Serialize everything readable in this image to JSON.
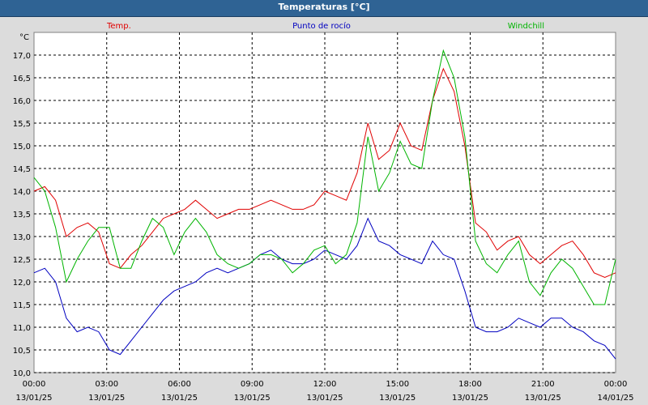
{
  "window": {
    "title": "Temperaturas [°C]"
  },
  "chart_data": {
    "type": "line",
    "ylabel": "°C",
    "ylim": [
      10.0,
      17.0
    ],
    "y_ticks": [
      "10,0",
      "10,5",
      "11,0",
      "11,5",
      "12,0",
      "12,5",
      "13,0",
      "13,5",
      "14,0",
      "14,5",
      "15,0",
      "15,5",
      "16,0",
      "16,5",
      "17,0"
    ],
    "xlim": [
      "2025-01-13T00:00",
      "2025-01-14T00:00"
    ],
    "x_ticks": [
      {
        "time": "00:00",
        "date": "13/01/25"
      },
      {
        "time": "03:00",
        "date": "13/01/25"
      },
      {
        "time": "06:00",
        "date": "13/01/25"
      },
      {
        "time": "09:00",
        "date": "13/01/25"
      },
      {
        "time": "12:00",
        "date": "13/01/25"
      },
      {
        "time": "15:00",
        "date": "13/01/25"
      },
      {
        "time": "18:00",
        "date": "13/01/25"
      },
      {
        "time": "21:00",
        "date": "13/01/25"
      },
      {
        "time": "00:00",
        "date": "14/01/25"
      }
    ],
    "grid": true,
    "x_hours": [
      0,
      0.5,
      1,
      1.5,
      2,
      2.5,
      3,
      3.5,
      4,
      4.5,
      5,
      5.5,
      6,
      6.5,
      7,
      7.5,
      8,
      8.5,
      9,
      9.5,
      10,
      10.5,
      11,
      11.5,
      12,
      12.5,
      13,
      13.5,
      14,
      14.5,
      15,
      15.5,
      16,
      16.5,
      17,
      17.5,
      18,
      18.5,
      19,
      19.5,
      20,
      20.5,
      21,
      21.5,
      22,
      22.5,
      23,
      23.5,
      24
    ],
    "series": [
      {
        "name": "Temp.",
        "color": "#e00000",
        "values": [
          14.0,
          14.1,
          13.8,
          13.0,
          13.2,
          13.3,
          13.1,
          12.4,
          12.3,
          12.6,
          12.8,
          13.1,
          13.4,
          13.5,
          13.6,
          13.8,
          13.6,
          13.4,
          13.5,
          13.6,
          13.6,
          13.7,
          13.8,
          13.7,
          13.6,
          13.6,
          13.7,
          14.0,
          13.9,
          13.8,
          14.4,
          15.5,
          14.7,
          14.9,
          15.5,
          15.0,
          14.9,
          16.0,
          16.7,
          16.2,
          15.0,
          13.3,
          13.1,
          12.7,
          12.9,
          13.0,
          12.6,
          12.4,
          12.6,
          12.8,
          12.9,
          12.6,
          12.2,
          12.1,
          12.2
        ]
      },
      {
        "name": "Punto de rocío",
        "color": "#0000c0",
        "values": [
          12.2,
          12.3,
          12.0,
          11.2,
          10.9,
          11.0,
          10.9,
          10.5,
          10.4,
          10.7,
          11.0,
          11.3,
          11.6,
          11.8,
          11.9,
          12.0,
          12.2,
          12.3,
          12.2,
          12.3,
          12.4,
          12.6,
          12.7,
          12.5,
          12.4,
          12.4,
          12.5,
          12.7,
          12.6,
          12.5,
          12.8,
          13.4,
          12.9,
          12.8,
          12.6,
          12.5,
          12.4,
          12.9,
          12.6,
          12.5,
          11.8,
          11.0,
          10.9,
          10.9,
          11.0,
          11.2,
          11.1,
          11.0,
          11.2,
          11.2,
          11.0,
          10.9,
          10.7,
          10.6,
          10.3
        ]
      },
      {
        "name": "Windchill",
        "color": "#00b400",
        "values": [
          14.3,
          14.0,
          13.2,
          12.0,
          12.5,
          12.9,
          13.2,
          13.2,
          12.3,
          12.3,
          12.9,
          13.4,
          13.2,
          12.6,
          13.1,
          13.4,
          13.1,
          12.6,
          12.4,
          12.3,
          12.4,
          12.6,
          12.6,
          12.5,
          12.2,
          12.4,
          12.7,
          12.8,
          12.4,
          12.6,
          13.3,
          15.2,
          14.0,
          14.4,
          15.1,
          14.6,
          14.5,
          16.0,
          17.1,
          16.5,
          15.2,
          12.9,
          12.4,
          12.2,
          12.6,
          12.9,
          12.0,
          11.7,
          12.2,
          12.5,
          12.3,
          11.9,
          11.5,
          11.5,
          12.5
        ]
      }
    ]
  }
}
